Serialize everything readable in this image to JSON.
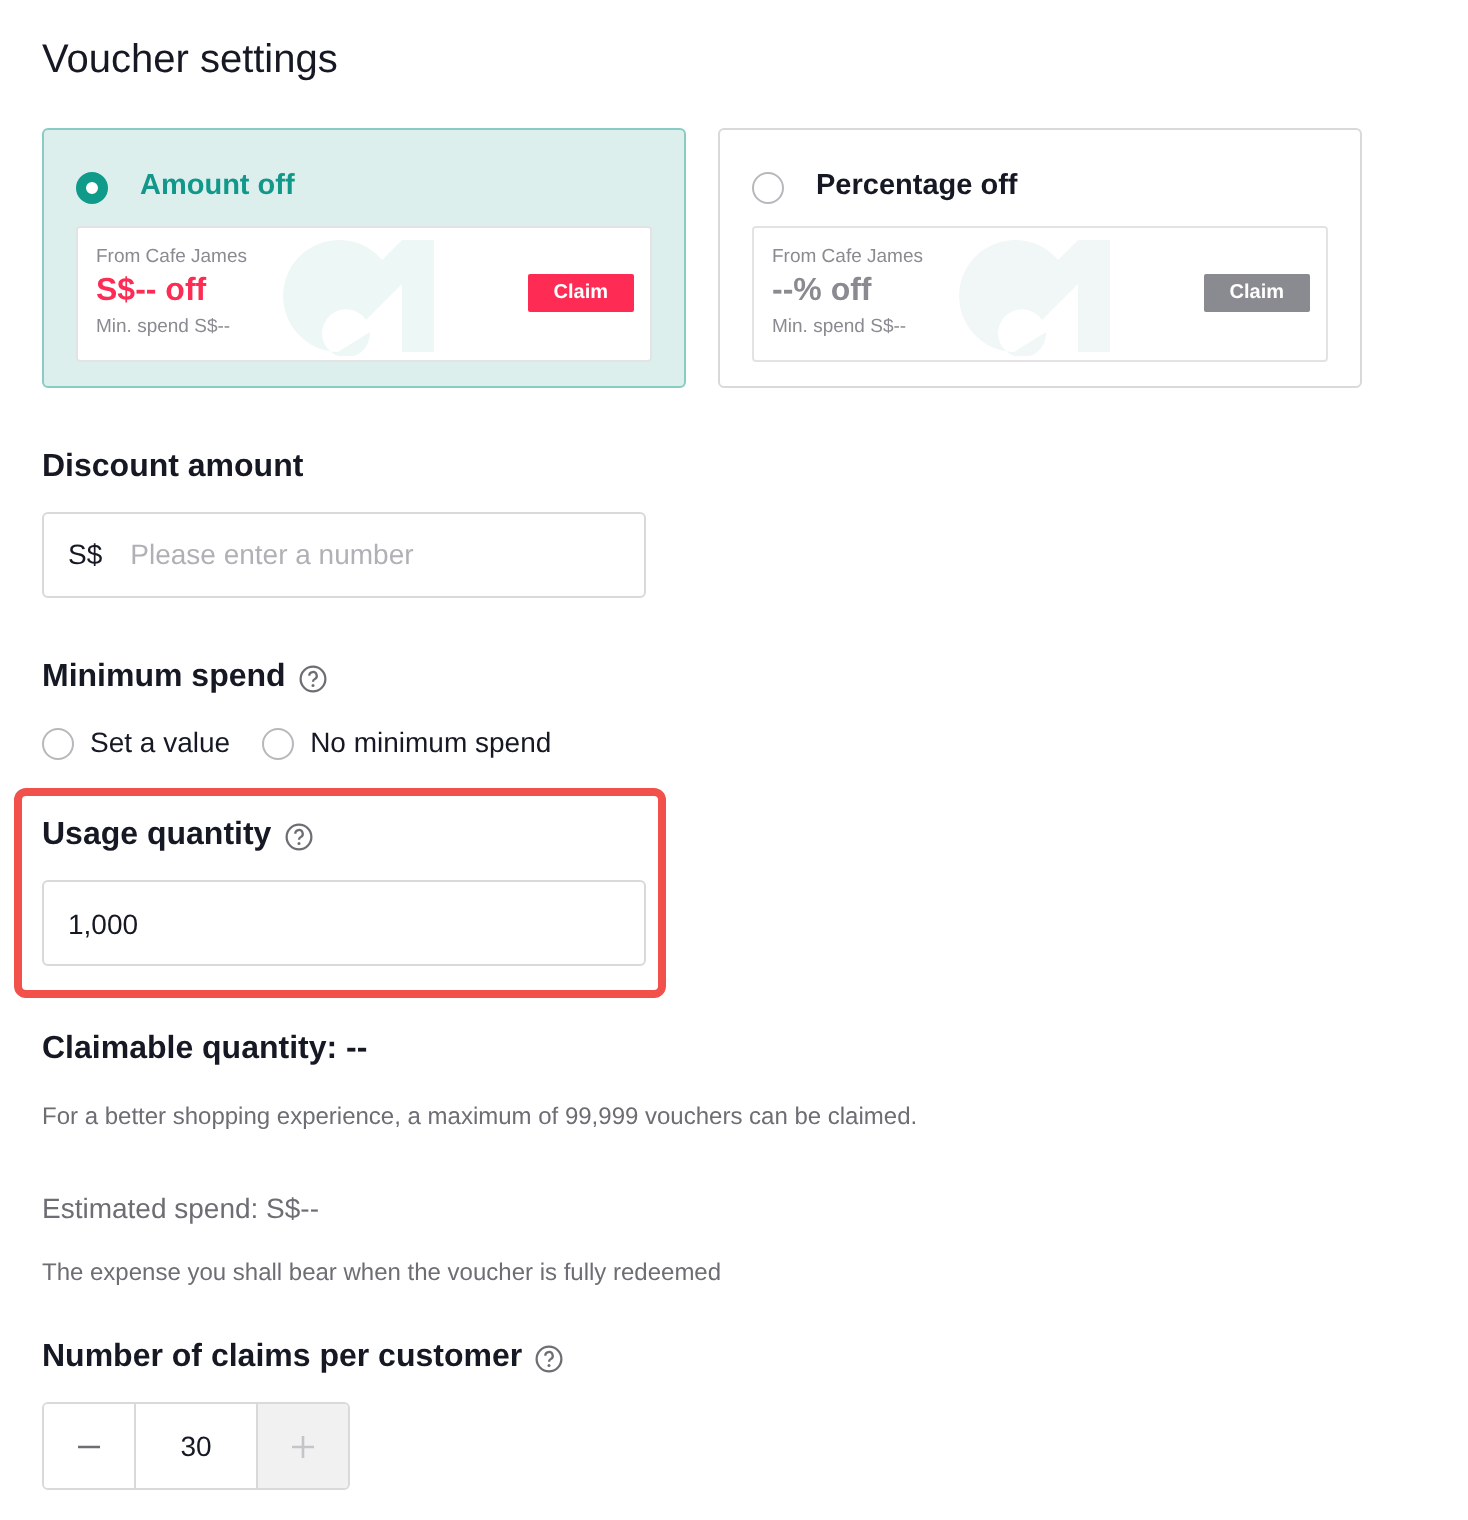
{
  "title": "Voucher settings",
  "voucher_types": [
    {
      "label": "Amount off",
      "selected": true,
      "preview": {
        "shop": "From Cafe James",
        "amount": "S$-- off",
        "min_spend": "Min. spend S$--",
        "button": "Claim"
      }
    },
    {
      "label": "Percentage off",
      "selected": false,
      "preview": {
        "shop": "From Cafe James",
        "amount": "--% off",
        "min_spend": "Min. spend S$--",
        "button": "Claim"
      }
    }
  ],
  "discount_amount": {
    "label": "Discount amount",
    "prefix": "S$",
    "placeholder": "Please enter a number"
  },
  "minimum_spend": {
    "label": "Minimum spend",
    "options": [
      {
        "label": "Set a value",
        "selected": false
      },
      {
        "label": "No minimum spend",
        "selected": false
      }
    ]
  },
  "usage_quantity": {
    "label": "Usage quantity",
    "value": "1,000",
    "highlighted": true
  },
  "claimable_quantity": {
    "label": "Claimable quantity: --",
    "note": "For a better shopping experience, a maximum of 99,999 vouchers can be claimed."
  },
  "estimated_spend": {
    "label": "Estimated spend: S$--",
    "note": "The expense you shall bear when the voucher is fully redeemed"
  },
  "claims_per_customer": {
    "label": "Number of claims per customer",
    "value": "30",
    "decrement": {
      "disabled": false
    },
    "increment": {
      "disabled": true
    }
  }
}
